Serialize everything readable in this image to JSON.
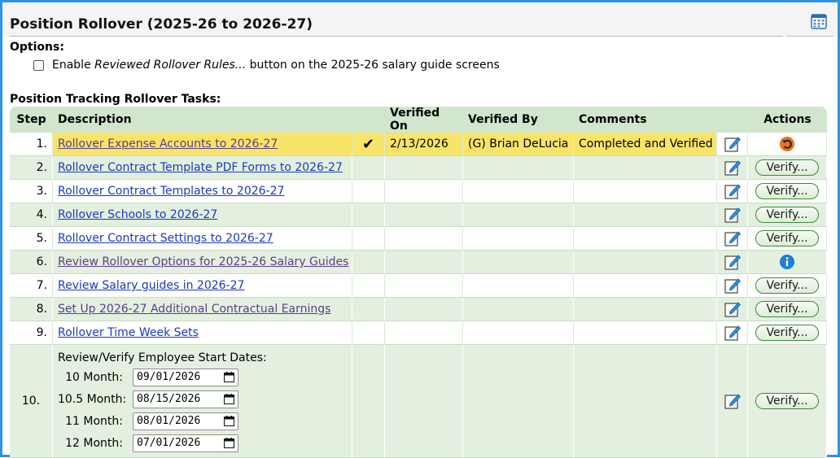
{
  "header": {
    "title": "Position Rollover (2025-26 to 2026-27)"
  },
  "options": {
    "label": "Options:",
    "enable_prefix": "Enable ",
    "enable_italic": "Reviewed Rollover Rules...",
    "enable_suffix": " button on the 2025-26 salary guide screens",
    "checked": false
  },
  "tasks_label": "Position Tracking Rollover Tasks:",
  "columns": {
    "step": "Step",
    "description": "Description",
    "verified_on": "Verified On",
    "verified_by": "Verified By",
    "comments": "Comments",
    "actions": "Actions"
  },
  "rows": [
    {
      "step": "1.",
      "description": "Rollover Expense Accounts to 2026-27",
      "check": "✔",
      "verified_on": "2/13/2026",
      "verified_by": "(G) Brian DeLucia",
      "comments": "Completed and Verified",
      "action": "undo-icon"
    },
    {
      "step": "2.",
      "description": "Rollover Contract Template PDF Forms to 2026-27",
      "action_label": "Verify..."
    },
    {
      "step": "3.",
      "description": "Rollover Contract Templates to 2026-27",
      "action_label": "Verify..."
    },
    {
      "step": "4.",
      "description": "Rollover Schools to 2026-27",
      "action_label": "Verify..."
    },
    {
      "step": "5.",
      "description": "Rollover Contract Settings to 2026-27",
      "action_label": "Verify..."
    },
    {
      "step": "6.",
      "description": "Review Rollover Options for 2025-26 Salary Guides",
      "action": "info-icon"
    },
    {
      "step": "7.",
      "description": "Review Salary guides in 2026-27",
      "action_label": "Verify..."
    },
    {
      "step": "8.",
      "description": "Set Up 2026-27 Additional Contractual Earnings",
      "action_label": "Verify..."
    },
    {
      "step": "9.",
      "description": "Rollover Time Week Sets",
      "action_label": "Verify..."
    }
  ],
  "row10": {
    "step": "10.",
    "heading": "Review/Verify Employee Start Dates:",
    "dates": [
      {
        "label": "10 Month:",
        "value": "09/01/2026"
      },
      {
        "label": "10.5 Month:",
        "value": "08/15/2026"
      },
      {
        "label": "11 Month:",
        "value": "08/01/2026"
      },
      {
        "label": "12 Month:",
        "value": "07/01/2026"
      }
    ],
    "action_label": "Verify..."
  },
  "colors": {
    "border": "#2c93e6",
    "highlight": "#f9e46a",
    "header_bg": "#d1e6cd",
    "link": "#1a39c4",
    "undo": "#e8731c",
    "info": "#1b7fd9"
  }
}
